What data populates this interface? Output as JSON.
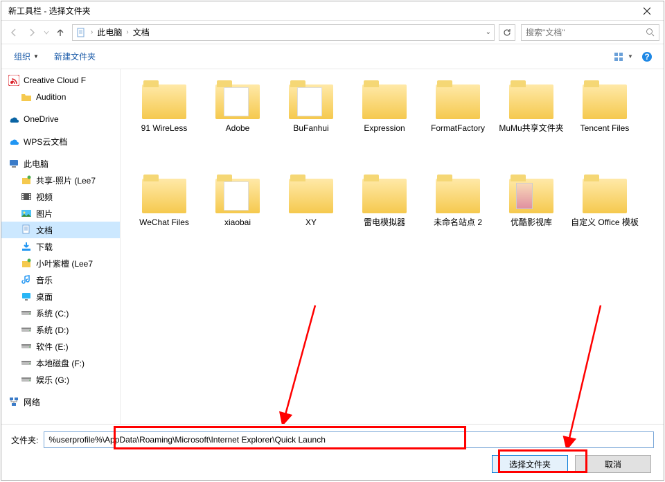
{
  "window": {
    "title": "新工具栏 - 选择文件夹"
  },
  "nav": {
    "breadcrumb": {
      "loc1": "此电脑",
      "loc2": "文档"
    },
    "search_placeholder": "搜索\"文档\""
  },
  "toolbar": {
    "organize": "组织",
    "newfolder": "新建文件夹"
  },
  "sidebar": {
    "items": [
      {
        "label": "Creative Cloud F",
        "icon": "cc"
      },
      {
        "label": "Audition",
        "icon": "folder-sm",
        "indent": 1
      },
      {
        "label": "OneDrive",
        "icon": "onedrive"
      },
      {
        "label": "WPS云文档",
        "icon": "wps"
      },
      {
        "label": "此电脑",
        "icon": "pc"
      },
      {
        "label": "共享-照片 (Lee7",
        "icon": "share",
        "indent": 1
      },
      {
        "label": "视频",
        "icon": "video",
        "indent": 1
      },
      {
        "label": "图片",
        "icon": "pictures",
        "indent": 1
      },
      {
        "label": "文档",
        "icon": "documents",
        "indent": 1,
        "selected": true
      },
      {
        "label": "下载",
        "icon": "downloads",
        "indent": 1
      },
      {
        "label": "小叶紫檀 (Lee7",
        "icon": "share",
        "indent": 1
      },
      {
        "label": "音乐",
        "icon": "music",
        "indent": 1
      },
      {
        "label": "桌面",
        "icon": "desktop",
        "indent": 1
      },
      {
        "label": "系统 (C:)",
        "icon": "drive",
        "indent": 1
      },
      {
        "label": "系统 (D:)",
        "icon": "drive",
        "indent": 1
      },
      {
        "label": "软件 (E:)",
        "icon": "drive",
        "indent": 1
      },
      {
        "label": "本地磁盘 (F:)",
        "icon": "drive",
        "indent": 1
      },
      {
        "label": "娱乐 (G:)",
        "icon": "drive",
        "indent": 1
      },
      {
        "label": "网络",
        "icon": "network"
      }
    ]
  },
  "content": {
    "items": [
      {
        "label": "91 WireLess",
        "type": "plain"
      },
      {
        "label": "Adobe",
        "type": "doc"
      },
      {
        "label": "BuFanhui",
        "type": "doc"
      },
      {
        "label": "Expression",
        "type": "plain"
      },
      {
        "label": "FormatFactory",
        "type": "plain"
      },
      {
        "label": "MuMu共享文件夹",
        "type": "plain"
      },
      {
        "label": "Tencent Files",
        "type": "plain"
      },
      {
        "label": "WeChat Files",
        "type": "plain"
      },
      {
        "label": "xiaobai",
        "type": "doc"
      },
      {
        "label": "XY",
        "type": "plain"
      },
      {
        "label": "雷电模拟器",
        "type": "plain"
      },
      {
        "label": "未命名站点 2",
        "type": "plain"
      },
      {
        "label": "优酷影视库",
        "type": "video"
      },
      {
        "label": "自定义 Office 模板",
        "type": "plain"
      }
    ]
  },
  "footer": {
    "path_label": "文件夹:",
    "path_value": "%userprofile%\\AppData\\Roaming\\Microsoft\\Internet Explorer\\Quick Launch",
    "select_btn": "选择文件夹",
    "cancel_btn": "取消"
  }
}
